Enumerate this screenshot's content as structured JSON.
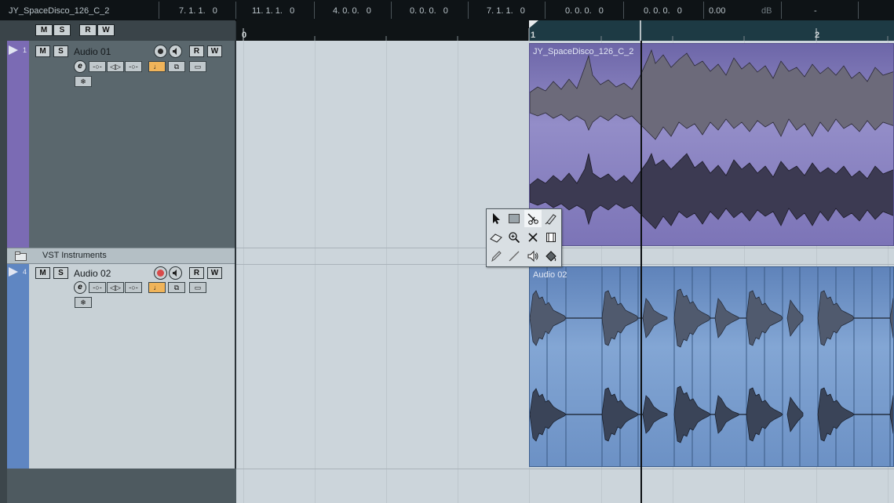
{
  "info_line": {
    "name": "JY_SpaceDisco_126_C_2",
    "fields": [
      "7. 1. 1.   0",
      "11. 1. 1.   0",
      "4. 0. 0.   0",
      "0. 0. 0.   0",
      "7. 1. 1.   0",
      "0. 0. 0.   0",
      "0. 0. 0.   0",
      "0.00",
      "dB",
      "-"
    ]
  },
  "track_list_header": {
    "buttons": [
      "M",
      "S",
      "R",
      "W"
    ]
  },
  "ruler": {
    "markers": [
      "0",
      "1",
      "2"
    ]
  },
  "tracks": [
    {
      "number": "1",
      "name": "Audio 01",
      "color": "#7b6bb4",
      "mute": "M",
      "solo": "S",
      "read": "R",
      "write": "W",
      "edit": "e",
      "record_enabled": false
    },
    {
      "name": "VST Instruments",
      "type": "folder"
    },
    {
      "number": "4",
      "name": "Audio 02",
      "color": "#5f86c2",
      "mute": "M",
      "solo": "S",
      "read": "R",
      "write": "W",
      "edit": "e",
      "record_enabled": true
    }
  ],
  "events": [
    {
      "title": "JY_SpaceDisco_126_C_2",
      "track": "Audio 01",
      "color": "#7b73b3"
    },
    {
      "title": "Audio 02",
      "track": "Audio 02",
      "color": "#6f93c5"
    }
  ],
  "toolbox": {
    "tools": [
      "object-selection-tool",
      "range-selection-tool",
      "split-tool",
      "glue-tool",
      "erase-tool",
      "zoom-tool",
      "mute-tool",
      "time-warp-tool",
      "draw-tool",
      "line-tool",
      "play-tool",
      "color-tool"
    ],
    "selected": "split-tool"
  },
  "colors": {
    "info_bg": "#0e1316",
    "project_bg": "#ccd5db",
    "audio01": "#7b6bb4",
    "audio02": "#5f86c2",
    "record_active": "#d84a4a",
    "monitor_active": "#f0b45a"
  }
}
